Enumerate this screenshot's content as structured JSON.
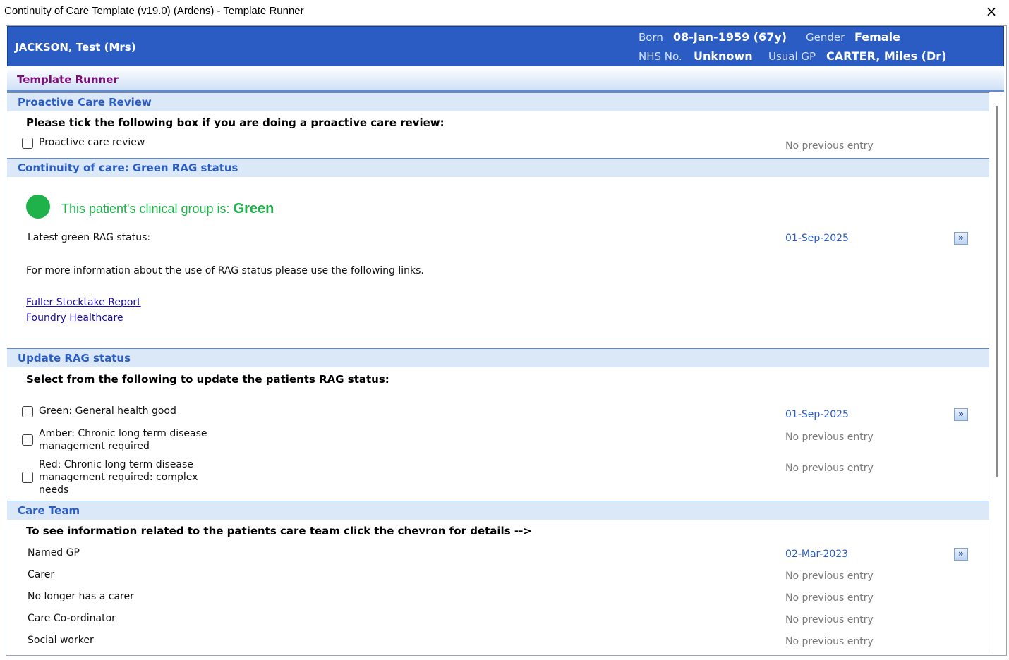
{
  "window": {
    "title": "Continuity of Care Template (v19.0) (Ardens) - Template Runner",
    "close_icon": "×"
  },
  "patient": {
    "name": "JACKSON,  Test (Mrs)",
    "born_label": "Born",
    "born_value": "08-Jan-1959 (67y)",
    "gender_label": "Gender",
    "gender_value": "Female",
    "nhs_label": "NHS No.",
    "nhs_value": "Unknown",
    "gp_label": "Usual GP",
    "gp_value": "CARTER, Miles (Dr)"
  },
  "runner_title": "Template Runner",
  "sections": {
    "proactive": {
      "header": "Proactive Care Review",
      "instruction": "Please tick the following box if you are doing a proactive care review:",
      "checkbox_label": "Proactive care review",
      "status": "No previous entry"
    },
    "green": {
      "header": "Continuity of care: Green RAG status",
      "message_prefix": "This patient's clinical group is:",
      "message_value": "Green",
      "latest_label": "Latest green RAG status:",
      "latest_date": "01-Sep-2025",
      "info_text": "For more information about the use of RAG status please use the following links.",
      "links": [
        "Fuller Stocktake Report",
        "Foundry Healthcare"
      ]
    },
    "update": {
      "header": "Update RAG status",
      "instruction": "Select from the following to update the patients RAG status:",
      "options": [
        {
          "label": "Green: General health good",
          "status": "01-Sep-2025"
        },
        {
          "label": "Amber: Chronic long term disease\nmanagement required",
          "status": "No previous entry"
        },
        {
          "label": "Red: Chronic long term disease\nmanagement required: complex\nneeds",
          "status": "No previous entry"
        }
      ]
    },
    "careteam": {
      "header": "Care Team",
      "instruction": "To see information related to the patients care team click the chevron for details -->",
      "rows": [
        {
          "label": "Named GP",
          "status": "02-Mar-2023"
        },
        {
          "label": "Carer",
          "status": "No previous entry"
        },
        {
          "label": "No longer has a carer",
          "status": "No previous entry"
        },
        {
          "label": "Care Co-ordinator",
          "status": "No previous entry"
        },
        {
          "label": "Social worker",
          "status": "No previous entry"
        }
      ]
    }
  },
  "chevron_glyph": "»",
  "colors": {
    "banner": "#2a5cc3",
    "section_header_text": "#2a5cc3",
    "green": "#1fb24a",
    "runner_title": "#7a0f7a"
  }
}
